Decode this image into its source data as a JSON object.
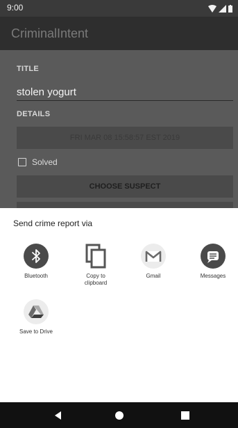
{
  "status_bar": {
    "time": "9:00"
  },
  "app_bar": {
    "title": "CriminalIntent"
  },
  "crime_form": {
    "title_label": "TITLE",
    "title_value": "stolen yogurt",
    "details_label": "DETAILS",
    "date_button": "FRI MAR 08 15:58:57 EST 2019",
    "solved_label": "Solved",
    "solved_checked": false,
    "suspect_button": "CHOOSE SUSPECT"
  },
  "share_sheet": {
    "title": "Send crime report via",
    "targets": [
      {
        "label": "Bluetooth",
        "icon": "bluetooth-icon"
      },
      {
        "label": "Copy to\nclipboard",
        "icon": "copy-icon"
      },
      {
        "label": "Gmail",
        "icon": "gmail-icon"
      },
      {
        "label": "Messages",
        "icon": "messages-icon"
      },
      {
        "label": "Save to Drive",
        "icon": "drive-icon"
      }
    ]
  },
  "nav_bar": {
    "buttons": [
      "back-icon",
      "home-icon",
      "recents-icon"
    ]
  }
}
